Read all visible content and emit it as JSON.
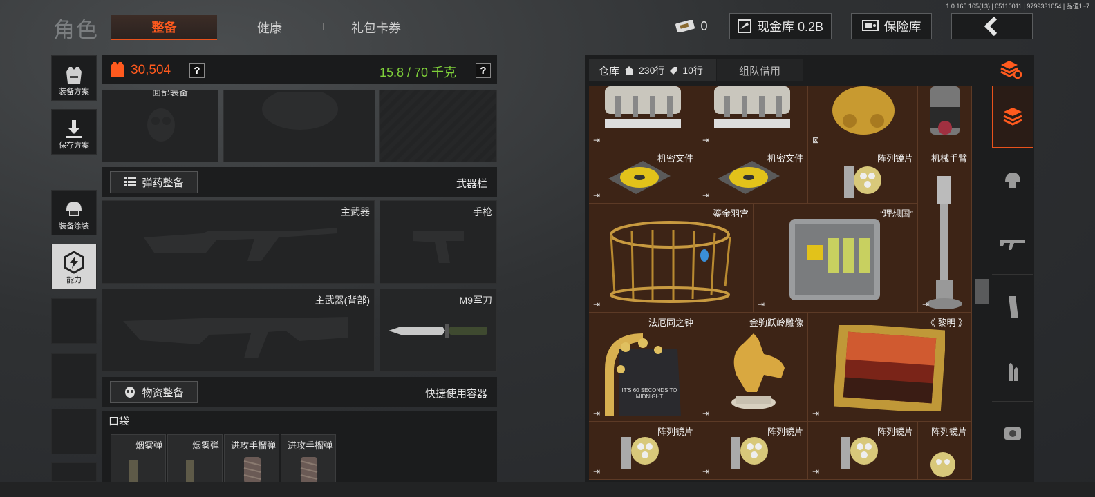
{
  "version": "1.0.165.165(13) | 05110011 | 9799331054 | 品值1~7",
  "header": {
    "title": "角色",
    "tabs": [
      {
        "label": "整备",
        "active": true
      },
      {
        "label": "健康",
        "active": false
      },
      {
        "label": "礼包卡券",
        "active": false
      }
    ],
    "ticket_count": "0",
    "cash_label": "现金库 0.2B",
    "safe_label": "保险库"
  },
  "sidebar": {
    "items": [
      {
        "label": "装备方案",
        "icon": "vest-icon"
      },
      {
        "label": "保存方案",
        "icon": "download-icon"
      },
      {
        "label": "装备涂装",
        "icon": "helmet-icon"
      },
      {
        "label": "能力",
        "icon": "ability-icon"
      }
    ]
  },
  "loadout": {
    "value": "30,504",
    "weight": "15.8 / 70 千克",
    "help": "?",
    "top_slot_label": "面部装备",
    "ammo_button": "弹药整备",
    "weapon_bar": "武器栏",
    "weapons": [
      {
        "label": "主武器"
      },
      {
        "label": "手枪"
      },
      {
        "label": "主武器(背部)"
      },
      {
        "label": "M9军刀"
      }
    ],
    "supply_button": "物资整备",
    "quick_container": "快捷使用容器",
    "pocket_label": "口袋",
    "pockets": [
      "烟雾弹",
      "烟雾弹",
      "进攻手榴弹",
      "进攻手榴弹"
    ]
  },
  "warehouse": {
    "tab_label": "仓库",
    "rows_label": "230行",
    "extra_rows_label": "10行",
    "team_label": "组队借用",
    "items": [
      {
        "name": "",
        "icon": "reactor-icon"
      },
      {
        "name": "",
        "icon": "reactor-icon"
      },
      {
        "name": "",
        "icon": "gold-statue-icon"
      },
      {
        "name": "",
        "icon": "canister-icon"
      },
      {
        "name": "机密文件",
        "icon": "disk-icon"
      },
      {
        "name": "机密文件",
        "icon": "disk-icon"
      },
      {
        "name": "阵列镜片",
        "icon": "lens-icon"
      },
      {
        "name": "机械手臂",
        "icon": "robot-arm-icon"
      },
      {
        "name": "鎏金羽宫",
        "icon": "birdcage-icon"
      },
      {
        "name": "“理想国”",
        "icon": "biohazard-case-icon"
      },
      {
        "name": "法厄同之钟",
        "icon": "clock-icon"
      },
      {
        "name": "金驹跃岭雕像",
        "icon": "horse-statue-icon"
      },
      {
        "name": "《 黎明 》",
        "icon": "painting-icon"
      },
      {
        "name": "阵列镜片",
        "icon": "lens-icon"
      },
      {
        "name": "阵列镜片",
        "icon": "lens-icon"
      },
      {
        "name": "阵列镜片",
        "icon": "lens-icon"
      },
      {
        "name": "阵列镜片",
        "icon": "lens-icon"
      }
    ],
    "clock_caption": "IT'S 60 SECONDS TO MIDNIGHT",
    "categories": [
      "stack-refresh-icon",
      "layers-icon",
      "helmet-icon",
      "rifle-icon",
      "magazine-icon",
      "bullet-icon",
      "scope-icon"
    ]
  },
  "colors": {
    "accent": "#e8521c",
    "weight_green": "#7fd03a",
    "warehouse_bg": "#3d2416"
  }
}
